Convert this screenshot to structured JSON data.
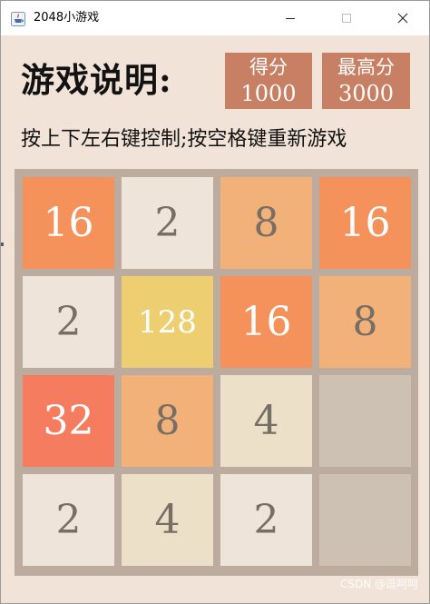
{
  "window": {
    "title": "2048小游戏",
    "minimize_icon": "minimize-icon",
    "maximize_icon": "maximize-icon",
    "close_icon": "close-icon"
  },
  "header": {
    "heading": "游戏说明:",
    "score_label": "得分",
    "score_value": "1000",
    "best_label": "最高分",
    "best_value": "3000",
    "instructions": "按上下左右键控制;按空格键重新游戏"
  },
  "board": {
    "rows": [
      [
        {
          "value": "16",
          "bg": "#f5915a",
          "fg": "#ffffff"
        },
        {
          "value": "2",
          "bg": "#eee4da",
          "fg": "#776e65"
        },
        {
          "value": "8",
          "bg": "#f2b179",
          "fg": "#776e65"
        },
        {
          "value": "16",
          "bg": "#f5915a",
          "fg": "#ffffff"
        }
      ],
      [
        {
          "value": "2",
          "bg": "#eee4da",
          "fg": "#776e65"
        },
        {
          "value": "128",
          "bg": "#edcf72",
          "fg": "#ffffff"
        },
        {
          "value": "16",
          "bg": "#f5915a",
          "fg": "#ffffff"
        },
        {
          "value": "8",
          "bg": "#f2b179",
          "fg": "#776e65"
        }
      ],
      [
        {
          "value": "32",
          "bg": "#f67c5f",
          "fg": "#ffffff"
        },
        {
          "value": "8",
          "bg": "#f2b179",
          "fg": "#776e65"
        },
        {
          "value": "4",
          "bg": "#ede0c8",
          "fg": "#776e65"
        },
        {
          "value": "",
          "bg": "#cdc1b4",
          "fg": "#776e65"
        }
      ],
      [
        {
          "value": "2",
          "bg": "#eee4da",
          "fg": "#776e65"
        },
        {
          "value": "4",
          "bg": "#ede0c8",
          "fg": "#776e65"
        },
        {
          "value": "2",
          "bg": "#eee4da",
          "fg": "#776e65"
        },
        {
          "value": "",
          "bg": "#cdc1b4",
          "fg": "#776e65"
        }
      ]
    ]
  },
  "watermark": "CSDN @逗呵呵"
}
